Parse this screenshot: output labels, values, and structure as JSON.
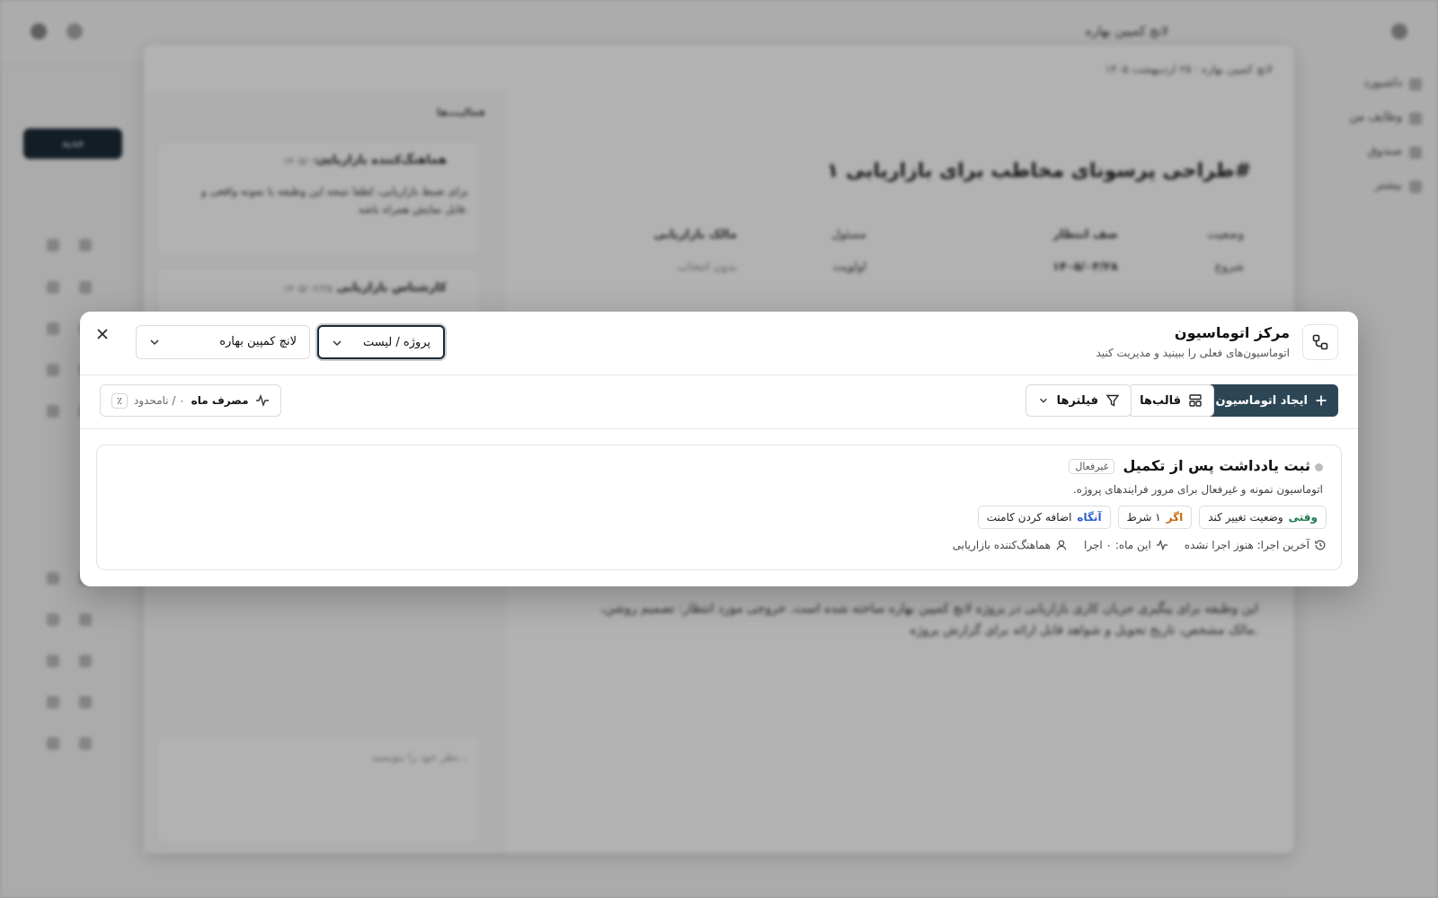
{
  "modal": {
    "title": "مرکز اتوماسیون",
    "subtitle": "اتوماسیون‌های فعلی را ببینید و مدیریت کنید",
    "view_select": "پروژه / لیست",
    "project_select": "لانچ کمپین بهاره",
    "toolbar": {
      "create_label": "ایجاد اتوماسیون",
      "templates_label": "قالب‌ها",
      "filters_label": "فیلترها"
    },
    "usage": {
      "label": "مصرف ماه",
      "count": "۰ / نامحدود",
      "percent": "٪"
    },
    "automation": {
      "title": "ثبت یادداشت پس از تکمیل",
      "status": "غیرفعال",
      "description": "اتوماسیون نمونه و غیرفعال برای مرور فرایندهای پروژه.",
      "when_key": "وقتی",
      "when_value": "وضعیت تغییر کند",
      "if_key": "اگر",
      "if_value": "۱ شرط",
      "then_key": "آنگاه",
      "then_value": "اضافه کردن کامنت",
      "last_run": "آخرین اجرا: هنوز اجرا نشده",
      "month_runs": "این ماه: ۰ اجرا",
      "owner": "هماهنگ‌کننده بازاریابی"
    },
    "colors": {
      "primary": "#2c4656",
      "when": "#1f7a4d",
      "if": "#c26a12",
      "then": "#2d5fd0"
    }
  },
  "background": {
    "app_title": "لانچ کمپین بهاره",
    "breadcrumb": "لانچ کمپین بهاره · ۲۵ اردیبهشت ۱۴۰۵",
    "task_title": "طراحی پرسونای مخاطب برای بازاریابی ۱#",
    "status_label": "وضعیت",
    "status_value": "صف انتظار",
    "start_label": "شروع",
    "start_value": "۱۴۰۵/۰۳/۲۸",
    "assignee_label": "مسئول",
    "assignee_value": "مالک بازاریابی",
    "priority_label": "اولویت",
    "priority_value": "بدون انتخاب",
    "activity_label": "فعالیت‌ها",
    "comment1_author": "هماهنگ‌کننده بازاریابی",
    "comment1_date": "۱۴۰۵/۰۲/۲۵",
    "comment1_body": "برای ضبط بازاریابی، لطفا نتیجه این وظیفه با نمونه واقعی و قابل نمایش همراه باشد.",
    "comment2_author": "کارشناس بازاریابی",
    "comment2_date": "۱۴۰۵/۰۲/۲۵",
    "description": "این وظیفه برای پیگیری جریان کاری بازاریابی در پروژه لانچ کمپین بهاره ساخته شده است. خروجی مورد انتظار: تصمیم روشن، مالک مشخص، تاریخ تحویل و شواهد قابل ارائه برای گزارش پروژه.",
    "comment_placeholder": "نظر خود را بنویسید...",
    "new_button": "جدید",
    "nav": [
      "داشبورد",
      "وظایف من",
      "صندوق",
      "بیشتر"
    ]
  }
}
